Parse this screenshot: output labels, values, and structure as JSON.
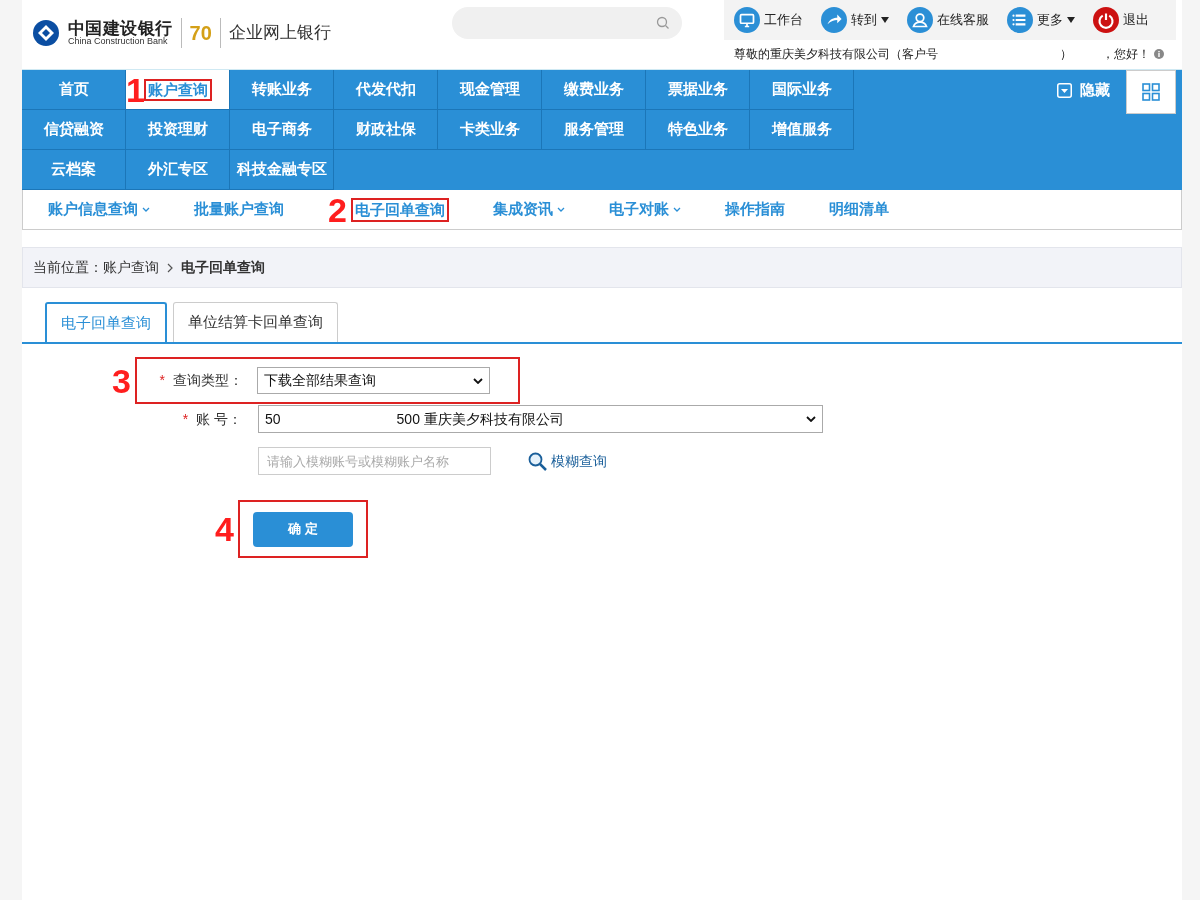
{
  "header": {
    "logo_cn": "中国建设银行",
    "logo_en": "China Construction Bank",
    "anniversary": "70",
    "product": "企业网上银行",
    "toolbar": [
      {
        "kind": "desktop",
        "label": "工作台",
        "dropdown": false
      },
      {
        "kind": "forward",
        "label": "转到",
        "dropdown": true
      },
      {
        "kind": "service",
        "label": "在线客服",
        "dropdown": false
      },
      {
        "kind": "list",
        "label": "更多",
        "dropdown": true
      },
      {
        "kind": "power",
        "label": "退出",
        "dropdown": false
      }
    ],
    "greeting": [
      "尊敬的重庆美夕科技有限公司（客户号",
      "）",
      "，您好！"
    ]
  },
  "main_nav": {
    "rows": [
      [
        {
          "label": "首页",
          "selected": false
        },
        {
          "label": "账户查询",
          "selected": true,
          "marker": "1"
        },
        {
          "label": "转账业务",
          "selected": false
        },
        {
          "label": "代发代扣",
          "selected": false
        },
        {
          "label": "现金管理",
          "selected": false
        },
        {
          "label": "缴费业务",
          "selected": false
        },
        {
          "label": "票据业务",
          "selected": false
        },
        {
          "label": "国际业务",
          "selected": false
        }
      ],
      [
        {
          "label": "信贷融资",
          "selected": false
        },
        {
          "label": "投资理财",
          "selected": false
        },
        {
          "label": "电子商务",
          "selected": false
        },
        {
          "label": "财政社保",
          "selected": false
        },
        {
          "label": "卡类业务",
          "selected": false
        },
        {
          "label": "服务管理",
          "selected": false
        },
        {
          "label": "特色业务",
          "selected": false
        },
        {
          "label": "增值服务",
          "selected": false
        }
      ],
      [
        {
          "label": "云档案",
          "selected": false
        },
        {
          "label": "外汇专区",
          "selected": false
        },
        {
          "label": "科技金融专区",
          "selected": false
        }
      ]
    ],
    "hide": "隐藏"
  },
  "sub_nav": [
    {
      "label": "账户信息查询",
      "dropdown": true
    },
    {
      "label": "批量账户查询",
      "dropdown": false
    },
    {
      "label": "电子回单查询",
      "dropdown": false,
      "marker": "2"
    },
    {
      "label": "集成资讯",
      "dropdown": true
    },
    {
      "label": "电子对账",
      "dropdown": true
    },
    {
      "label": "操作指南",
      "dropdown": false
    },
    {
      "label": "明细清单",
      "dropdown": false
    }
  ],
  "breadcrumb": {
    "prefix": "当前位置：账户查询",
    "current": "电子回单查询"
  },
  "tabs": [
    {
      "label": "电子回单查询",
      "selected": true
    },
    {
      "label": "单位结算卡回单查询",
      "selected": false
    }
  ],
  "form": {
    "query_type": {
      "label": "查询类型：",
      "required_mark": "*",
      "value": "下载全部结果查询",
      "marker": "3"
    },
    "account": {
      "label": "账 号：",
      "required_mark": "*",
      "value_start": "50",
      "value_end": "500 重庆美夕科技有限公司"
    },
    "fuzzy": {
      "placeholder": "请输入模糊账号或模糊账户名称",
      "link": "模糊查询"
    },
    "submit": {
      "label": "确 定",
      "marker": "4"
    }
  }
}
